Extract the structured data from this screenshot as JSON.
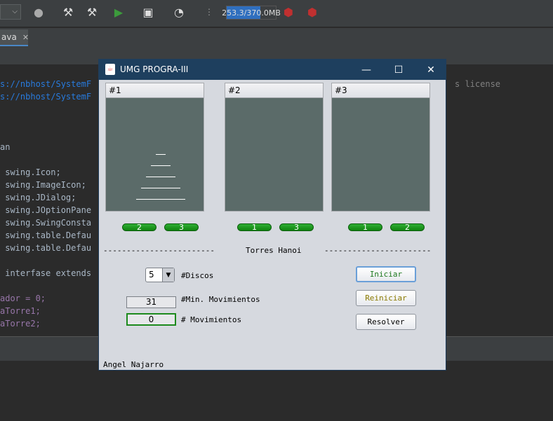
{
  "ide": {
    "memory_label": "253.3/370.0MB",
    "memory_fraction": 0.68,
    "tab_label": "ava",
    "code_lines": [
      {
        "text": "s://nbhost/SystemF",
        "color": "#287bde"
      },
      {
        "text": "s://nbhost/SystemF",
        "color": "#287bde"
      },
      {
        "text": "",
        "color": "#a9b7c6"
      },
      {
        "text": "",
        "color": "#a9b7c6"
      },
      {
        "text": "",
        "color": "#a9b7c6"
      },
      {
        "text": "an",
        "color": "#a9b7c6"
      },
      {
        "text": "",
        "color": "#a9b7c6"
      },
      {
        "text": " swing.Icon;",
        "color": "#a9b7c6"
      },
      {
        "text": " swing.ImageIcon;",
        "color": "#a9b7c6"
      },
      {
        "text": " swing.JDialog;",
        "color": "#a9b7c6"
      },
      {
        "text": " swing.JOptionPane",
        "color": "#a9b7c6"
      },
      {
        "text": " swing.SwingConsta",
        "color": "#a9b7c6"
      },
      {
        "text": " swing.table.Defau",
        "color": "#a9b7c6"
      },
      {
        "text": " swing.table.Defau",
        "color": "#a9b7c6"
      },
      {
        "text": "",
        "color": "#a9b7c6"
      },
      {
        "text": " interfase extends",
        "color": "#a9b7c6"
      },
      {
        "text": "",
        "color": "#a9b7c6"
      },
      {
        "text": "ador = 0;",
        "color": "#9876aa"
      },
      {
        "text": "aTorre1;",
        "color": "#9876aa"
      },
      {
        "text": "aTorre2;",
        "color": "#9876aa"
      }
    ],
    "right_code": "s license"
  },
  "dialog": {
    "title": "UMG PROGRA-III",
    "towers": [
      {
        "label": "#1",
        "buttons": [
          "2",
          "3"
        ],
        "disks": [
          1,
          2,
          3,
          4,
          5
        ]
      },
      {
        "label": "#2",
        "buttons": [
          "1",
          "3"
        ],
        "disks": []
      },
      {
        "label": "#3",
        "buttons": [
          "1",
          "2"
        ],
        "disks": []
      }
    ],
    "separator_left": "------------------------",
    "separator_title": "Torres Hanoi",
    "separator_right": "-----------------------",
    "discos": {
      "value": "5",
      "label": "#Discos"
    },
    "min_moves": {
      "value": "31",
      "label": "#Min. Movimientos"
    },
    "moves": {
      "value": "0",
      "label": "# Movimientos"
    },
    "buttons": {
      "iniciar": "Iniciar",
      "reiniciar": "Reiniciar",
      "resolver": "Resolver"
    },
    "author": "Angel Najarro"
  }
}
